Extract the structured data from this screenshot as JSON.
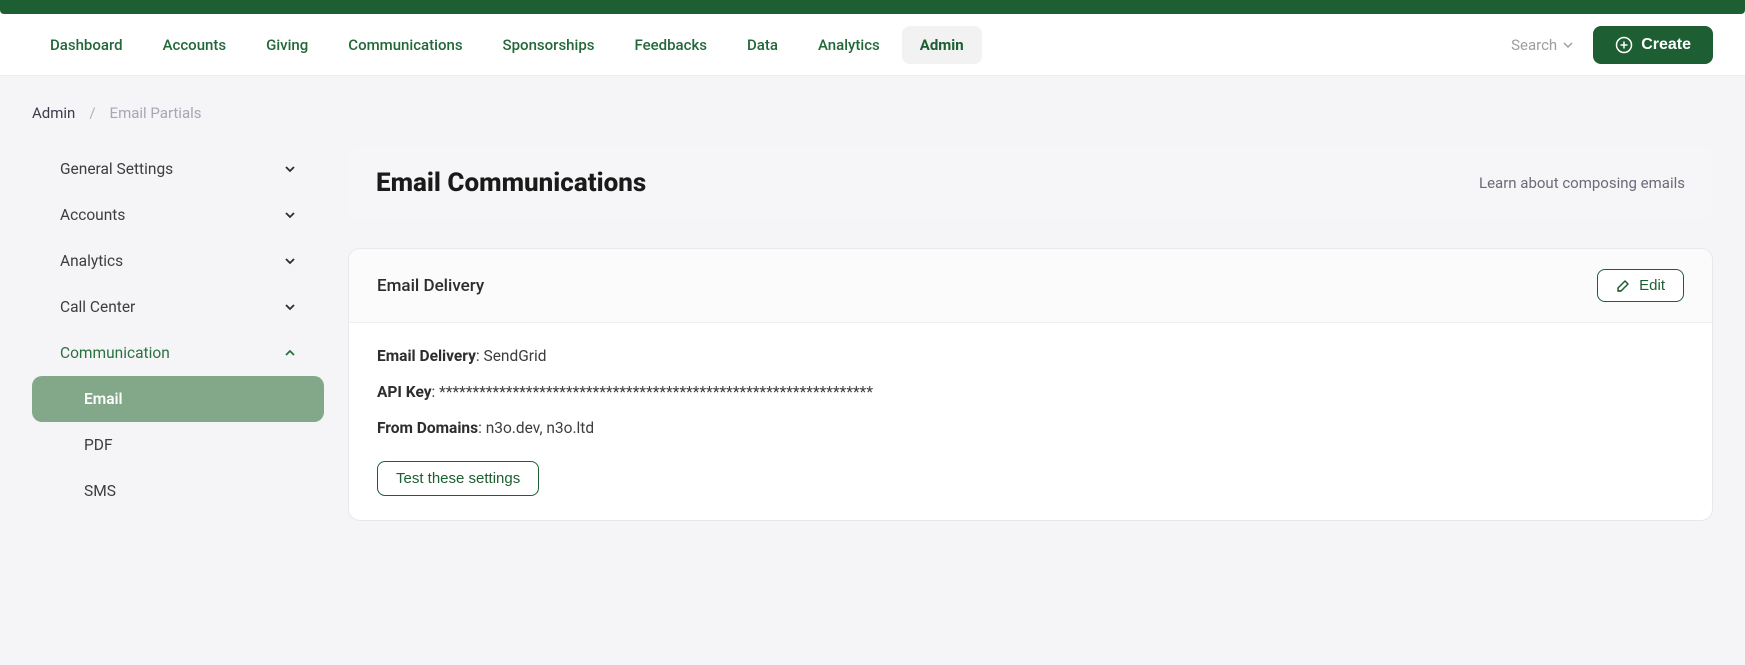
{
  "nav": {
    "items": [
      {
        "label": "Dashboard"
      },
      {
        "label": "Accounts"
      },
      {
        "label": "Giving"
      },
      {
        "label": "Communications"
      },
      {
        "label": "Sponsorships"
      },
      {
        "label": "Feedbacks"
      },
      {
        "label": "Data"
      },
      {
        "label": "Analytics"
      },
      {
        "label": "Admin",
        "active": true
      }
    ],
    "search_label": "Search",
    "create_label": "Create"
  },
  "breadcrumb": {
    "first": "Admin",
    "last": "Email Partials"
  },
  "sidebar": {
    "items": [
      {
        "label": "General Settings",
        "expanded": false
      },
      {
        "label": "Accounts",
        "expanded": false
      },
      {
        "label": "Analytics",
        "expanded": false
      },
      {
        "label": "Call Center",
        "expanded": false
      },
      {
        "label": "Communication",
        "expanded": true
      }
    ],
    "sub": [
      {
        "label": "Email",
        "active": true
      },
      {
        "label": "PDF"
      },
      {
        "label": "SMS"
      }
    ]
  },
  "page": {
    "title": "Email Communications",
    "help_link": "Learn about composing emails"
  },
  "card": {
    "title": "Email Delivery",
    "edit_label": "Edit",
    "rows": {
      "delivery_label": "Email Delivery",
      "delivery_value": "SendGrid",
      "api_label": "API Key",
      "api_value": "*****************************************************************",
      "domains_label": "From Domains",
      "domains_value": "n3o.dev, n3o.ltd"
    },
    "test_label": "Test these settings"
  }
}
